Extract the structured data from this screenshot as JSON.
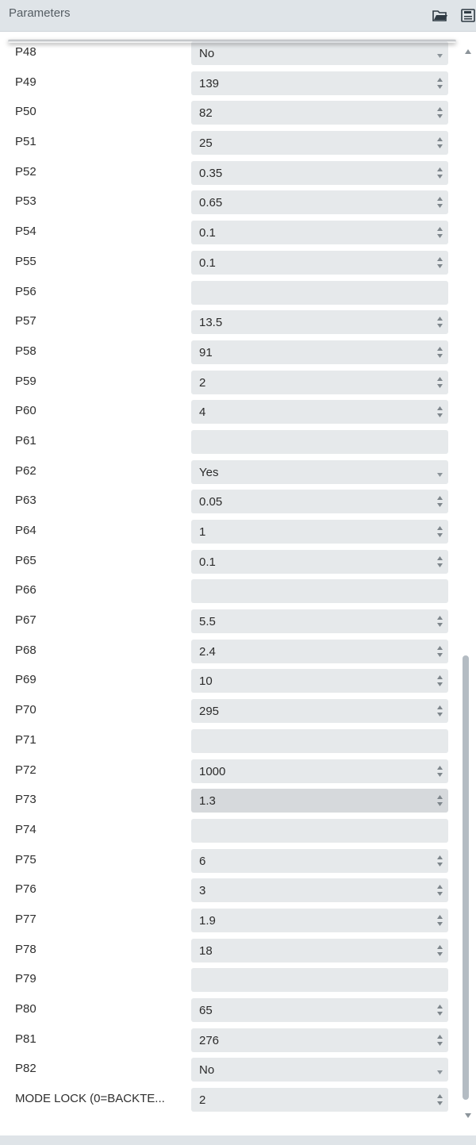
{
  "panel": {
    "title": "Parameters"
  },
  "icons": {
    "open": "folder-open-icon",
    "save": "save-icon"
  },
  "parameters": [
    {
      "label": "P48",
      "value": "No",
      "control": "select"
    },
    {
      "label": "P49",
      "value": "139",
      "control": "spinner"
    },
    {
      "label": "P50",
      "value": "82",
      "control": "spinner"
    },
    {
      "label": "P51",
      "value": "25",
      "control": "spinner"
    },
    {
      "label": "P52",
      "value": "0.35",
      "control": "spinner"
    },
    {
      "label": "P53",
      "value": "0.65",
      "control": "spinner"
    },
    {
      "label": "P54",
      "value": "0.1",
      "control": "spinner"
    },
    {
      "label": "P55",
      "value": "0.1",
      "control": "spinner"
    },
    {
      "label": "P56",
      "value": "",
      "control": "text"
    },
    {
      "label": "P57",
      "value": "13.5",
      "control": "spinner"
    },
    {
      "label": "P58",
      "value": "91",
      "control": "spinner"
    },
    {
      "label": "P59",
      "value": "2",
      "control": "spinner"
    },
    {
      "label": "P60",
      "value": "4",
      "control": "spinner"
    },
    {
      "label": "P61",
      "value": "",
      "control": "text"
    },
    {
      "label": "P62",
      "value": "Yes",
      "control": "select"
    },
    {
      "label": "P63",
      "value": "0.05",
      "control": "spinner"
    },
    {
      "label": "P64",
      "value": "1",
      "control": "spinner"
    },
    {
      "label": "P65",
      "value": "0.1",
      "control": "spinner"
    },
    {
      "label": "P66",
      "value": "",
      "control": "text"
    },
    {
      "label": "P67",
      "value": "5.5",
      "control": "spinner"
    },
    {
      "label": "P68",
      "value": "2.4",
      "control": "spinner"
    },
    {
      "label": "P69",
      "value": "10",
      "control": "spinner"
    },
    {
      "label": "P70",
      "value": "295",
      "control": "spinner"
    },
    {
      "label": "P71",
      "value": "",
      "control": "text"
    },
    {
      "label": "P72",
      "value": "1000",
      "control": "spinner"
    },
    {
      "label": "P73",
      "value": "1.3",
      "control": "spinner",
      "focused": true
    },
    {
      "label": "P74",
      "value": "",
      "control": "text"
    },
    {
      "label": "P75",
      "value": "6",
      "control": "spinner"
    },
    {
      "label": "P76",
      "value": "3",
      "control": "spinner"
    },
    {
      "label": "P77",
      "value": "1.9",
      "control": "spinner"
    },
    {
      "label": "P78",
      "value": "18",
      "control": "spinner"
    },
    {
      "label": "P79",
      "value": "",
      "control": "text"
    },
    {
      "label": "P80",
      "value": "65",
      "control": "spinner"
    },
    {
      "label": "P81",
      "value": "276",
      "control": "spinner"
    },
    {
      "label": "P82",
      "value": "No",
      "control": "select"
    },
    {
      "label": "MODE LOCK (0=BACKTE...",
      "value": "2",
      "control": "spinner"
    }
  ]
}
